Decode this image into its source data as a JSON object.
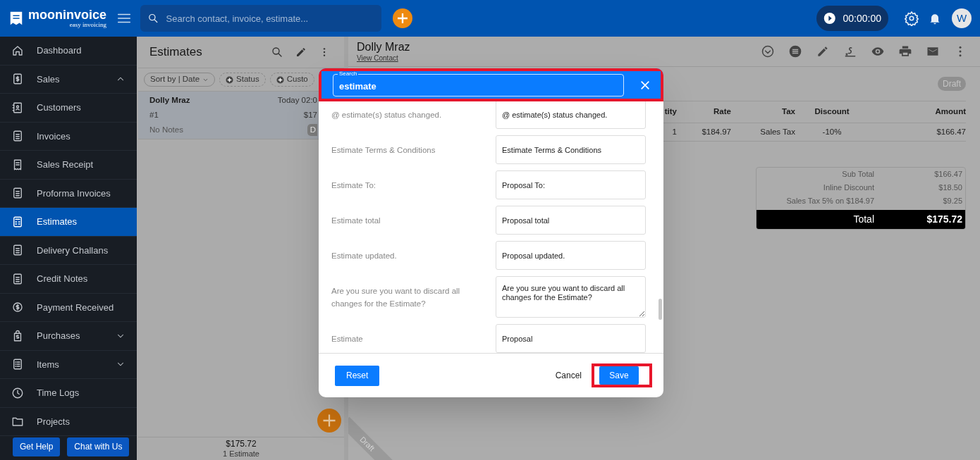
{
  "header": {
    "brand": "mooninvoice",
    "tagline": "easy invoicing",
    "search_placeholder": "Search contact, invoice, estimate...",
    "timer": "00:00:00",
    "avatar": "W"
  },
  "sidebar": {
    "items": [
      {
        "label": "Dashboard",
        "selected": false
      },
      {
        "label": "Sales",
        "selected": false,
        "expanded": true
      },
      {
        "label": "Customers",
        "selected": false
      },
      {
        "label": "Invoices",
        "selected": false
      },
      {
        "label": "Sales Receipt",
        "selected": false
      },
      {
        "label": "Proforma Invoices",
        "selected": false
      },
      {
        "label": "Estimates",
        "selected": true
      },
      {
        "label": "Delivery Challans",
        "selected": false
      },
      {
        "label": "Credit Notes",
        "selected": false
      },
      {
        "label": "Payment Received",
        "selected": false
      },
      {
        "label": "Purchases",
        "selected": false,
        "expanded": false
      },
      {
        "label": "Items",
        "selected": false,
        "expanded": false
      },
      {
        "label": "Time Logs",
        "selected": false
      },
      {
        "label": "Projects",
        "selected": false
      }
    ],
    "buttons": [
      "Get Help",
      "Chat with Us"
    ]
  },
  "list": {
    "title": "Estimates",
    "filters": [
      "Sort by | Date",
      "Status",
      "Custo"
    ],
    "items": [
      {
        "name": "Dolly Mraz",
        "date": "Today 02:0",
        "number": "#1",
        "amount": "$17",
        "notes": "No Notes",
        "badge": "D",
        "selected": true
      }
    ],
    "footer_total": "$175.72",
    "footer_count": "1 Estimate"
  },
  "detail": {
    "name": "Dolly Mraz",
    "link": "View Contact",
    "status": "Draft",
    "ribbon": "Draft",
    "table": {
      "columns": [
        "tity",
        "Rate",
        "Tax",
        "Discount",
        "Amount"
      ],
      "rows": [
        [
          "1",
          "$184.97",
          "Sales Tax",
          "-10%",
          "$166.47"
        ]
      ]
    },
    "totals": [
      {
        "label": "Sub Total",
        "value": "$166.47"
      },
      {
        "label": "Inline Discount",
        "value": "$18.50"
      },
      {
        "label": "Sales Tax 5% on $184.97",
        "value": "$9.25"
      }
    ],
    "total": {
      "label": "Total",
      "value": "$175.72"
    }
  },
  "dialog": {
    "search": {
      "label": "Search",
      "value": "estimate",
      "highlighted": true
    },
    "rows": [
      {
        "kind": "input",
        "label": "@ estimate(s) status changed.",
        "value": "@ estimate(s) status changed."
      },
      {
        "kind": "input",
        "label": "Estimate Terms & Conditions",
        "value": "Estimate Terms & Conditions"
      },
      {
        "kind": "input",
        "label": "Estimate To:",
        "value": "Proposal To:"
      },
      {
        "kind": "input",
        "label": "Estimate total",
        "value": "Proposal total"
      },
      {
        "kind": "input",
        "label": "Estimate updated.",
        "value": "Proposal updated."
      },
      {
        "kind": "textarea",
        "label": "Are you sure you want to discard all changes for the Estimate?",
        "value": "Are you sure you want to discard all changes for the Estimate?"
      },
      {
        "kind": "input",
        "label": "Estimate",
        "value": "Proposal"
      }
    ],
    "reset": "Reset",
    "cancel": "Cancel",
    "save": {
      "label": "Save",
      "highlighted": true
    }
  }
}
